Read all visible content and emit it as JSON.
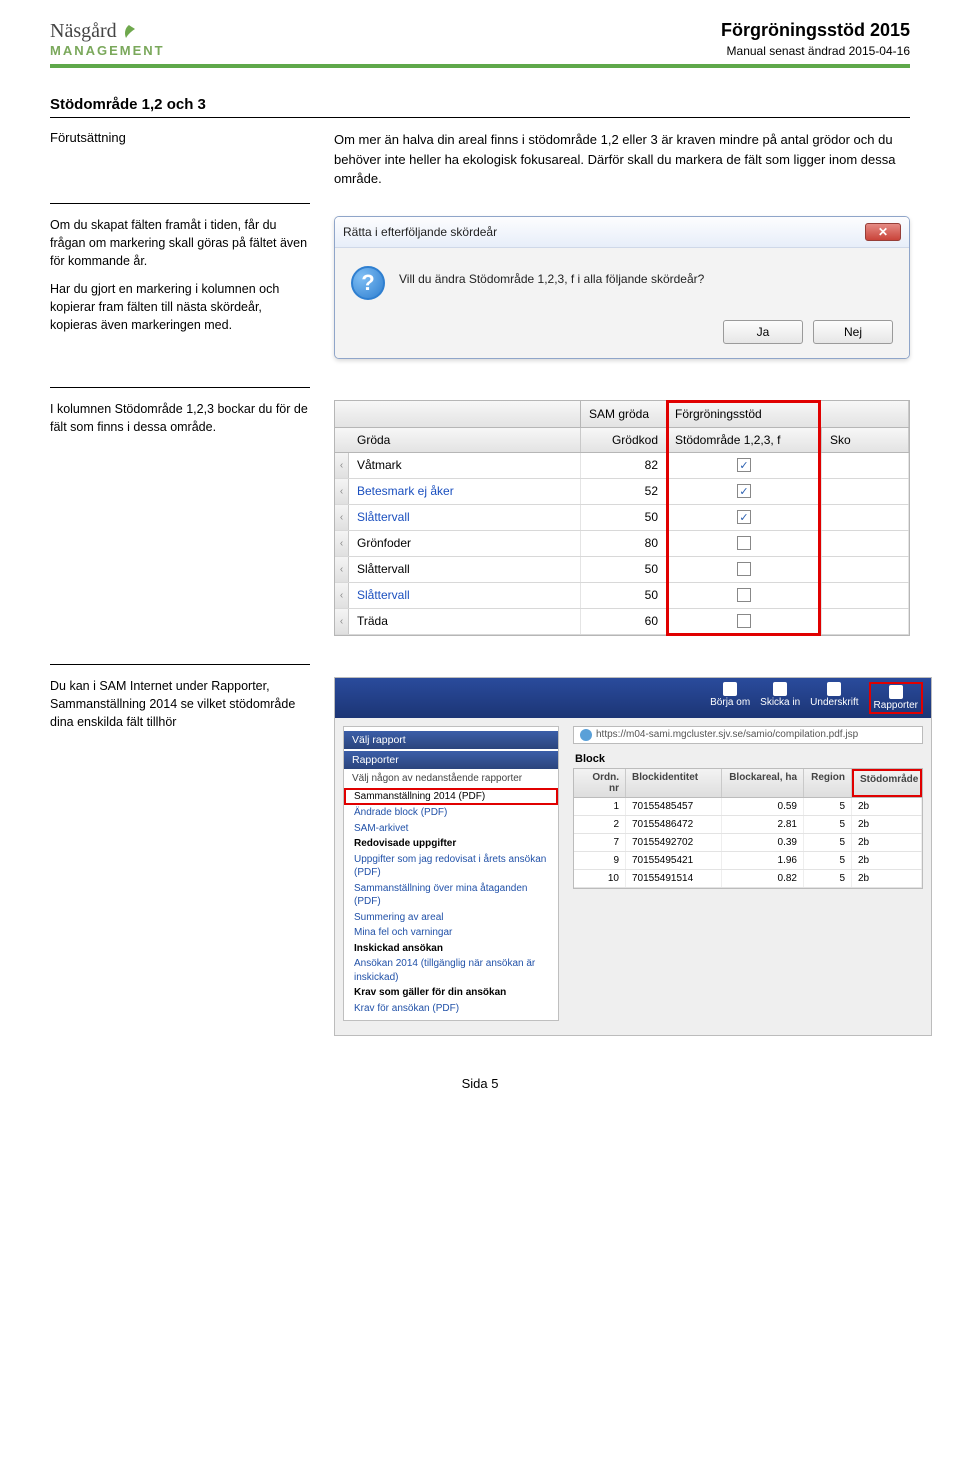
{
  "header": {
    "brand_top": "Näsgård",
    "brand_sub": "MANAGEMENT",
    "doc_title": "Förgröningsstöd 2015",
    "doc_date": "Manual senast ändrad 2015-04-16"
  },
  "section": {
    "title": "Stödområde 1,2 och 3",
    "prereq_label": "Förutsättning",
    "prereq_text": "Om mer än halva din areal finns i stödområde 1,2 eller 3 är kraven mindre på antal grödor och du behöver inte heller ha ekologisk fokusareal. Därför skall du markera de fält som ligger inom dessa område."
  },
  "block1": {
    "p1": "Om du skapat fälten framåt i tiden, får du frågan om markering skall göras på fältet även för kommande år.",
    "p2": "Har du gjort en markering i kolumnen och kopierar fram fälten till nästa skördeår, kopieras även markeringen med.",
    "dialog": {
      "title": "Rätta i efterföljande skördeår",
      "message": "Vill du ändra Stödområde 1,2,3, f i alla följande skördeår?",
      "yes": "Ja",
      "no": "Nej"
    }
  },
  "block2": {
    "text": "I kolumnen Stödområde 1,2,3 bockar du för de fält som finns i dessa område.",
    "grid": {
      "group_sam": "SAM gröda",
      "group_forg": "Förgröningsstöd",
      "col_groda": "Gröda",
      "col_kod": "Grödkod",
      "col_stod": "Stödområde 1,2,3, f",
      "col_sko": "Sko",
      "rows": [
        {
          "groda": "Våtmark",
          "kod": "82",
          "chk": true,
          "blue": false
        },
        {
          "groda": "Betesmark ej åker",
          "kod": "52",
          "chk": true,
          "blue": true
        },
        {
          "groda": "Slåttervall",
          "kod": "50",
          "chk": true,
          "blue": true
        },
        {
          "groda": "Grönfoder",
          "kod": "80",
          "chk": false,
          "blue": false
        },
        {
          "groda": "Slåttervall",
          "kod": "50",
          "chk": false,
          "blue": false
        },
        {
          "groda": "Slåttervall",
          "kod": "50",
          "chk": false,
          "blue": true
        },
        {
          "groda": "Träda",
          "kod": "60",
          "chk": false,
          "blue": false
        }
      ]
    }
  },
  "block3": {
    "text": "Du kan i SAM Internet under Rapporter, Sammanställning 2014 se vilket stödområde dina enskilda fält tillhör",
    "sam": {
      "top_items": [
        "Börja om",
        "Skicka in",
        "Underskrift",
        "Rapporter"
      ],
      "left_header1": "Välj rapport",
      "left_header2": "Rapporter",
      "select_hint": "Välj någon av nedanstående rapporter",
      "items": [
        {
          "label": "Sammanställning 2014   (PDF)",
          "bold": false,
          "hl": true
        },
        {
          "label": "Ändrade block   (PDF)",
          "bold": false
        },
        {
          "label": "SAM-arkivet",
          "bold": false
        },
        {
          "label": "Redovisade uppgifter",
          "bold": true
        },
        {
          "label": "Uppgifter som jag redovisat i årets ansökan   (PDF)",
          "bold": false
        },
        {
          "label": "Sammanställning över mina åtaganden   (PDF)",
          "bold": false
        },
        {
          "label": "Summering av areal",
          "bold": false
        },
        {
          "label": "Mina fel och varningar",
          "bold": false
        },
        {
          "label": "Inskickad ansökan",
          "bold": true
        },
        {
          "label": "Ansökan 2014 (tillgänglig när ansökan är inskickad)",
          "bold": false
        },
        {
          "label": "Krav som gäller för din ansökan",
          "bold": true
        },
        {
          "label": "Krav för ansökan   (PDF)",
          "bold": false
        }
      ],
      "url": "https://m04-sami.mgcluster.sjv.se/samio/compilation.pdf.jsp",
      "block_title": "Block",
      "cols": {
        "ord": "Ordn. nr",
        "id": "Blockidentitet",
        "areal": "Blockareal, ha",
        "region": "Region",
        "stod": "Stödområde"
      },
      "rows": [
        {
          "o": "1",
          "id": "70155485457",
          "ar": "0.59",
          "rg": "5",
          "st": "2b"
        },
        {
          "o": "2",
          "id": "70155486472",
          "ar": "2.81",
          "rg": "5",
          "st": "2b"
        },
        {
          "o": "7",
          "id": "70155492702",
          "ar": "0.39",
          "rg": "5",
          "st": "2b"
        },
        {
          "o": "9",
          "id": "70155495421",
          "ar": "1.96",
          "rg": "5",
          "st": "2b"
        },
        {
          "o": "10",
          "id": "70155491514",
          "ar": "0.82",
          "rg": "5",
          "st": "2b"
        }
      ]
    }
  },
  "footer": {
    "page": "Sida 5"
  }
}
